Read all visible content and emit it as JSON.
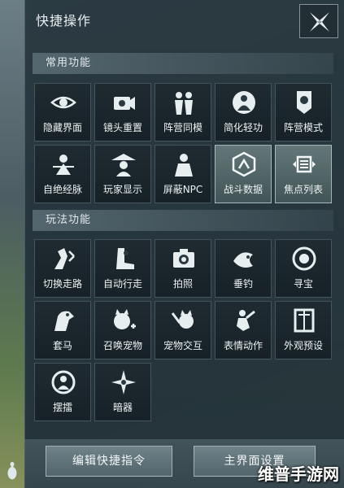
{
  "header": {
    "title": "快捷操作",
    "close_icon": "close-x-icon"
  },
  "sections": [
    {
      "title": "常用功能",
      "items": [
        {
          "label": "隐藏界面",
          "icon": "eye-icon",
          "active": false
        },
        {
          "label": "镜头重置",
          "icon": "camera-reset-icon",
          "active": false
        },
        {
          "label": "阵营同模",
          "icon": "faction-model-icon",
          "active": false
        },
        {
          "label": "简化轻功",
          "icon": "simplify-qinggong-icon",
          "active": false
        },
        {
          "label": "阵营模式",
          "icon": "faction-banner-icon",
          "active": false
        },
        {
          "label": "自绝经脉",
          "icon": "self-destruct-icon",
          "active": false
        },
        {
          "label": "玩家显示",
          "icon": "player-display-icon",
          "active": false
        },
        {
          "label": "屏蔽NPC",
          "icon": "hide-npc-icon",
          "active": false
        },
        {
          "label": "战斗数据",
          "icon": "battle-data-icon",
          "active": true
        },
        {
          "label": "焦点列表",
          "icon": "focus-list-icon",
          "active": true
        }
      ]
    },
    {
      "title": "玩法功能",
      "items": [
        {
          "label": "切换走路",
          "icon": "walk-toggle-icon",
          "active": false
        },
        {
          "label": "自动行走",
          "icon": "auto-walk-icon",
          "active": false
        },
        {
          "label": "拍照",
          "icon": "photo-camera-icon",
          "active": false
        },
        {
          "label": "垂钓",
          "icon": "fishing-icon",
          "active": false
        },
        {
          "label": "寻宝",
          "icon": "treasure-hunt-icon",
          "active": false
        },
        {
          "label": "套马",
          "icon": "lasso-horse-icon",
          "active": false
        },
        {
          "label": "召唤宠物",
          "icon": "summon-pet-icon",
          "active": false
        },
        {
          "label": "宠物交互",
          "icon": "pet-interact-icon",
          "active": false
        },
        {
          "label": "表情动作",
          "icon": "emote-icon",
          "active": false
        },
        {
          "label": "外观预设",
          "icon": "appearance-preset-icon",
          "active": false
        },
        {
          "label": "摆擂",
          "icon": "arena-icon",
          "active": false
        },
        {
          "label": "暗器",
          "icon": "hidden-weapon-icon",
          "active": false
        }
      ]
    }
  ],
  "buttons": {
    "edit": "编辑快捷指令",
    "main_ui": "主界面设置"
  },
  "watermark": "维普手游网",
  "colors": {
    "panel": "#24343b",
    "active_tile": "#6c8486",
    "text": "#edf2f3"
  }
}
